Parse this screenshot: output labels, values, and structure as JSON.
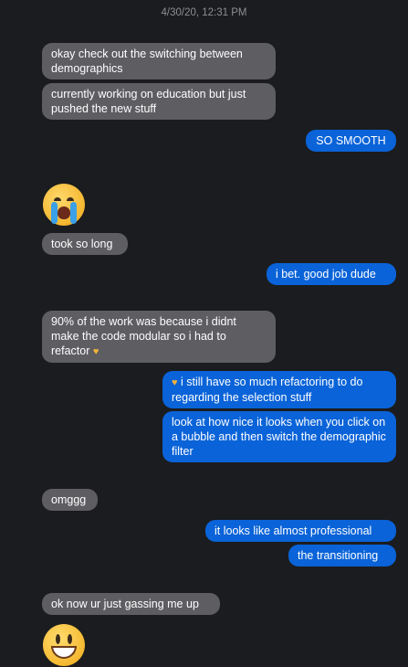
{
  "timestamp": "4/30/20, 12:31 PM",
  "messages": [
    {
      "text": "okay check out the switching between demographics"
    },
    {
      "text": "currently working on education but just pushed the new stuff"
    },
    {
      "text": "SO SMOOTH"
    },
    {
      "emoji": "loudly-crying-face-emoji"
    },
    {
      "text": "took so long"
    },
    {
      "text": "i bet. good job dude"
    },
    {
      "text": "90% of the work was because i didnt make the code modular so i had to refactor",
      "suffix_emoji": "yellow-heart-emoji"
    },
    {
      "text": "i still have so much refactoring to do regarding the selection stuff",
      "prefix_emoji": "yellow-heart-emoji"
    },
    {
      "text": "look at how nice it looks when you click on a bubble and then switch the demographic filter"
    },
    {
      "text": "omggg"
    },
    {
      "text": "it looks like almost professional"
    },
    {
      "text": "the transitioning"
    },
    {
      "text": "ok now ur just gassing me up"
    },
    {
      "emoji": "grinning-face-emoji"
    }
  ],
  "colors": {
    "background": "#1b1c1f",
    "received_bubble": "#5d5d62",
    "sent_bubble": "#0a63d8",
    "timestamp": "#8e8e93"
  }
}
